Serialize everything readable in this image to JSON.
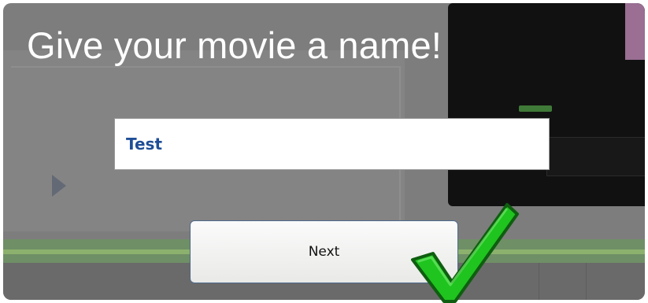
{
  "dialog": {
    "title": "Give your movie a name!",
    "name_value": "Test",
    "next_label": "Next"
  },
  "icons": {
    "confirm": "green-checkmark-icon",
    "background_play": "play-icon"
  },
  "colors": {
    "overlay": "#7d7d7d",
    "input_text": "#1f4e97",
    "checkmark": "#1fc41f",
    "checkmark_outline": "#0f5e10",
    "button_border": "#4d6a8c"
  }
}
